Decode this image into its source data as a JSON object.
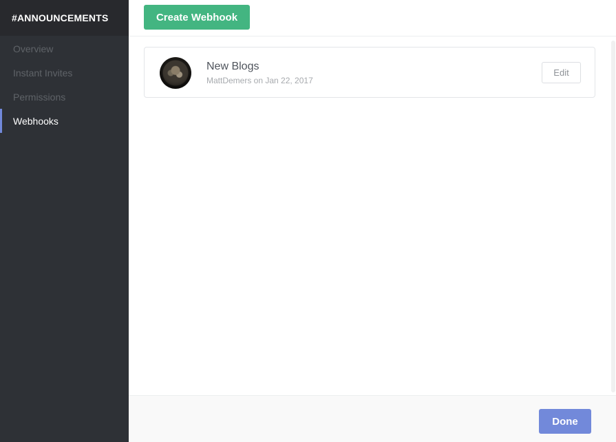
{
  "sidebar": {
    "channel_name": "#ANNOUNCEMENTS",
    "items": [
      {
        "label": "Overview"
      },
      {
        "label": "Instant Invites"
      },
      {
        "label": "Permissions"
      },
      {
        "label": "Webhooks",
        "active": true
      }
    ]
  },
  "toolbar": {
    "create_label": "Create Webhook"
  },
  "webhooks": [
    {
      "name": "New Blogs",
      "meta": "MattDemers on Jan 22, 2017",
      "edit_label": "Edit"
    }
  ],
  "footer": {
    "done_label": "Done"
  },
  "colors": {
    "sidebar_bg": "#2e3136",
    "header_bg": "#28292d",
    "active_indicator": "#7289da",
    "create_button": "#43b581",
    "done_button": "#7289da"
  }
}
